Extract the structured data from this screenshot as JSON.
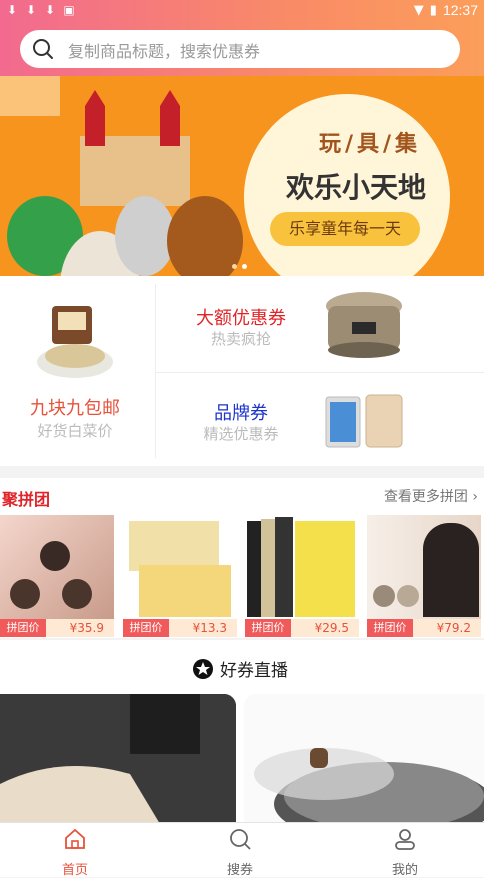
{
  "status_bar": {
    "time": "12:37"
  },
  "search": {
    "placeholder": "复制商品标题，搜索优惠券"
  },
  "banner": {
    "title_top": "玩/具/集",
    "title_main": "欢乐小天地",
    "pill": "乐享童年每一天"
  },
  "promo": {
    "left": {
      "title": "九块九包邮",
      "subtitle": "好货白菜价"
    },
    "right": [
      {
        "title": "大额优惠券",
        "subtitle": "热卖疯抢",
        "color": "#e0252a"
      },
      {
        "title": "品牌券",
        "subtitle": "精选优惠券",
        "color": "#1d35c9"
      }
    ]
  },
  "group_buy": {
    "title": "聚拼团",
    "more": "查看更多拼团",
    "items": [
      {
        "label": "拼团价",
        "price": "¥35.9"
      },
      {
        "label": "拼团价",
        "price": "¥13.3"
      },
      {
        "label": "拼团价",
        "price": "¥29.5"
      },
      {
        "label": "拼团价",
        "price": "¥79.2"
      }
    ]
  },
  "live": {
    "title": "好券直播"
  },
  "nav": {
    "items": [
      {
        "label": "首页",
        "icon": "home-icon",
        "active": true
      },
      {
        "label": "搜券",
        "icon": "search-icon",
        "active": false
      },
      {
        "label": "我的",
        "icon": "user-icon",
        "active": false
      }
    ]
  },
  "colors": {
    "accent": "#e8513a",
    "header_start": "#f26a8f",
    "header_end": "#fb9e5a"
  }
}
